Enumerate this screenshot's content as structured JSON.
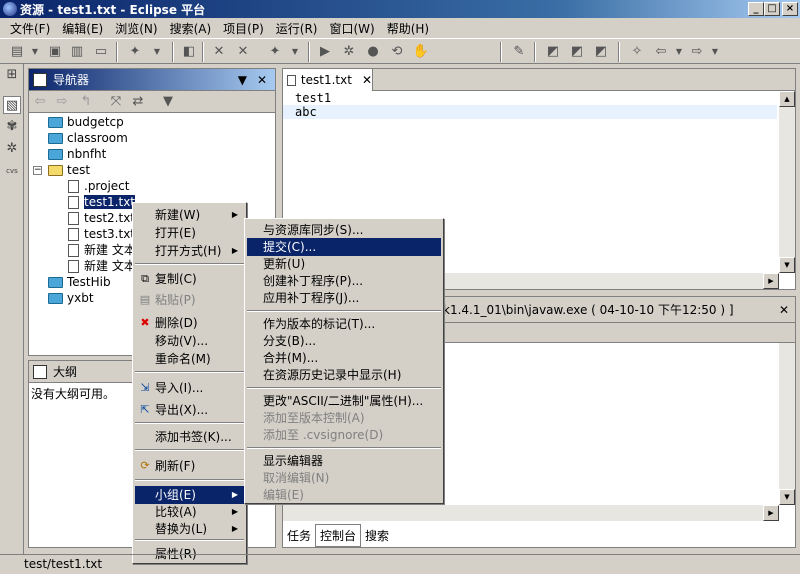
{
  "window": {
    "title": "资源 - test1.txt - Eclipse 平台"
  },
  "menubar": [
    "文件(F)",
    "编辑(E)",
    "浏览(N)",
    "搜索(A)",
    "项目(P)",
    "运行(R)",
    "窗口(W)",
    "帮助(H)"
  ],
  "navigator": {
    "title": "导航器",
    "tree": [
      "budgetcp",
      "classroom",
      "nbnfht",
      "test",
      ".project",
      "test1.txt",
      "test2.txt",
      "test3.txt",
      "新建 文本",
      "新建 文本",
      "TestHib",
      "yxbt"
    ]
  },
  "outline": {
    "title": "大纲",
    "empty": "没有大纲可用。"
  },
  "editor": {
    "tab": "test1.txt",
    "lines": [
      "test1",
      "abc"
    ]
  },
  "console": {
    "header": "k1.4.1_01\\bin\\javaw.exe ( 04-10-10 下午12:50 ) ]"
  },
  "bottom_tabs": [
    "任务",
    "控制台",
    "搜索"
  ],
  "context_menu": [
    {
      "label": "新建(W)",
      "arrow": true
    },
    {
      "label": "打开(E)"
    },
    {
      "label": "打开方式(H)",
      "arrow": true
    },
    {
      "label": "复制(C)",
      "icon": "copy-icon"
    },
    {
      "label": "粘贴(P)",
      "disabled": true,
      "icon": "paste-icon"
    },
    {
      "label": "删除(D)",
      "icon": "delete-icon"
    },
    {
      "label": "移动(V)..."
    },
    {
      "label": "重命名(M)"
    },
    {
      "label": "导入(I)...",
      "icon": "import-icon"
    },
    {
      "label": "导出(X)...",
      "icon": "export-icon"
    },
    {
      "label": "添加书签(K)..."
    },
    {
      "label": "刷新(F)",
      "icon": "refresh-icon"
    },
    {
      "label": "小组(E)",
      "arrow": true,
      "highlight": true
    },
    {
      "label": "比较(A)",
      "arrow": true
    },
    {
      "label": "替换为(L)",
      "arrow": true
    },
    {
      "label": "属性(R)"
    }
  ],
  "team_submenu": [
    {
      "label": "与资源库同步(S)..."
    },
    {
      "label": "提交(C)...",
      "highlight": true
    },
    {
      "label": "更新(U)"
    },
    {
      "label": "创建补丁程序(P)..."
    },
    {
      "label": "应用补丁程序(J)..."
    },
    {
      "label": "作为版本的标记(T)..."
    },
    {
      "label": "分支(B)..."
    },
    {
      "label": "合并(M)..."
    },
    {
      "label": "在资源历史记录中显示(H)"
    },
    {
      "label": "更改\"ASCII/二进制\"属性(H)..."
    },
    {
      "label": "添加至版本控制(A)",
      "disabled": true
    },
    {
      "label": "添加至 .cvsignore(D)",
      "disabled": true
    },
    {
      "label": "显示编辑器"
    },
    {
      "label": "取消编辑(N)",
      "disabled": true
    },
    {
      "label": "编辑(E)",
      "disabled": true
    }
  ],
  "statusbar": {
    "text": "test/test1.txt"
  },
  "colors": {
    "selection": "#0a246a",
    "chrome": "#d4d0c8",
    "title_start": "#0a246a",
    "current_line": "#e8f2fe"
  }
}
